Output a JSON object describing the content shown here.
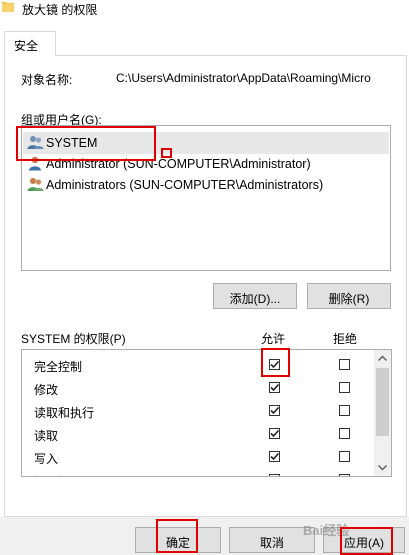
{
  "window": {
    "title": "放大镜 的权限"
  },
  "tabs": [
    {
      "label": "安全"
    }
  ],
  "object": {
    "label": "对象名称:",
    "value": "C:\\Users\\Administrator\\AppData\\Roaming\\Micro"
  },
  "groups": {
    "label": "组或用户名(G):",
    "items": [
      {
        "name": "SYSTEM",
        "selected": true
      },
      {
        "name": "Administrator (SUN-COMPUTER\\Administrator)",
        "selected": false
      },
      {
        "name": "Administrators (SUN-COMPUTER\\Administrators)",
        "selected": false
      }
    ],
    "add_label": "添加(D)...",
    "remove_label": "删除(R)"
  },
  "permissions": {
    "title": "SYSTEM 的权限(P)",
    "allow_header": "允许",
    "deny_header": "拒绝",
    "rows": [
      {
        "name": "完全控制",
        "allow": true,
        "deny": false
      },
      {
        "name": "修改",
        "allow": true,
        "deny": false
      },
      {
        "name": "读取和执行",
        "allow": true,
        "deny": false
      },
      {
        "name": "读取",
        "allow": true,
        "deny": false
      },
      {
        "name": "写入",
        "allow": true,
        "deny": false
      },
      {
        "name": "特殊权限",
        "allow": false,
        "deny": false
      }
    ]
  },
  "footer": {
    "ok_label": "确定",
    "cancel_label": "取消",
    "apply_label": "应用(A)"
  },
  "watermark": "Bai经验",
  "colors": {
    "highlight_box": "#e00000",
    "selection": "#e8e8e8",
    "button": "#e1e1e1"
  },
  "icons": [
    "folder-icon",
    "user-group-icon",
    "user-icon",
    "checkmark-icon",
    "scroll-up-arrow-icon",
    "scroll-down-arrow-icon"
  ]
}
